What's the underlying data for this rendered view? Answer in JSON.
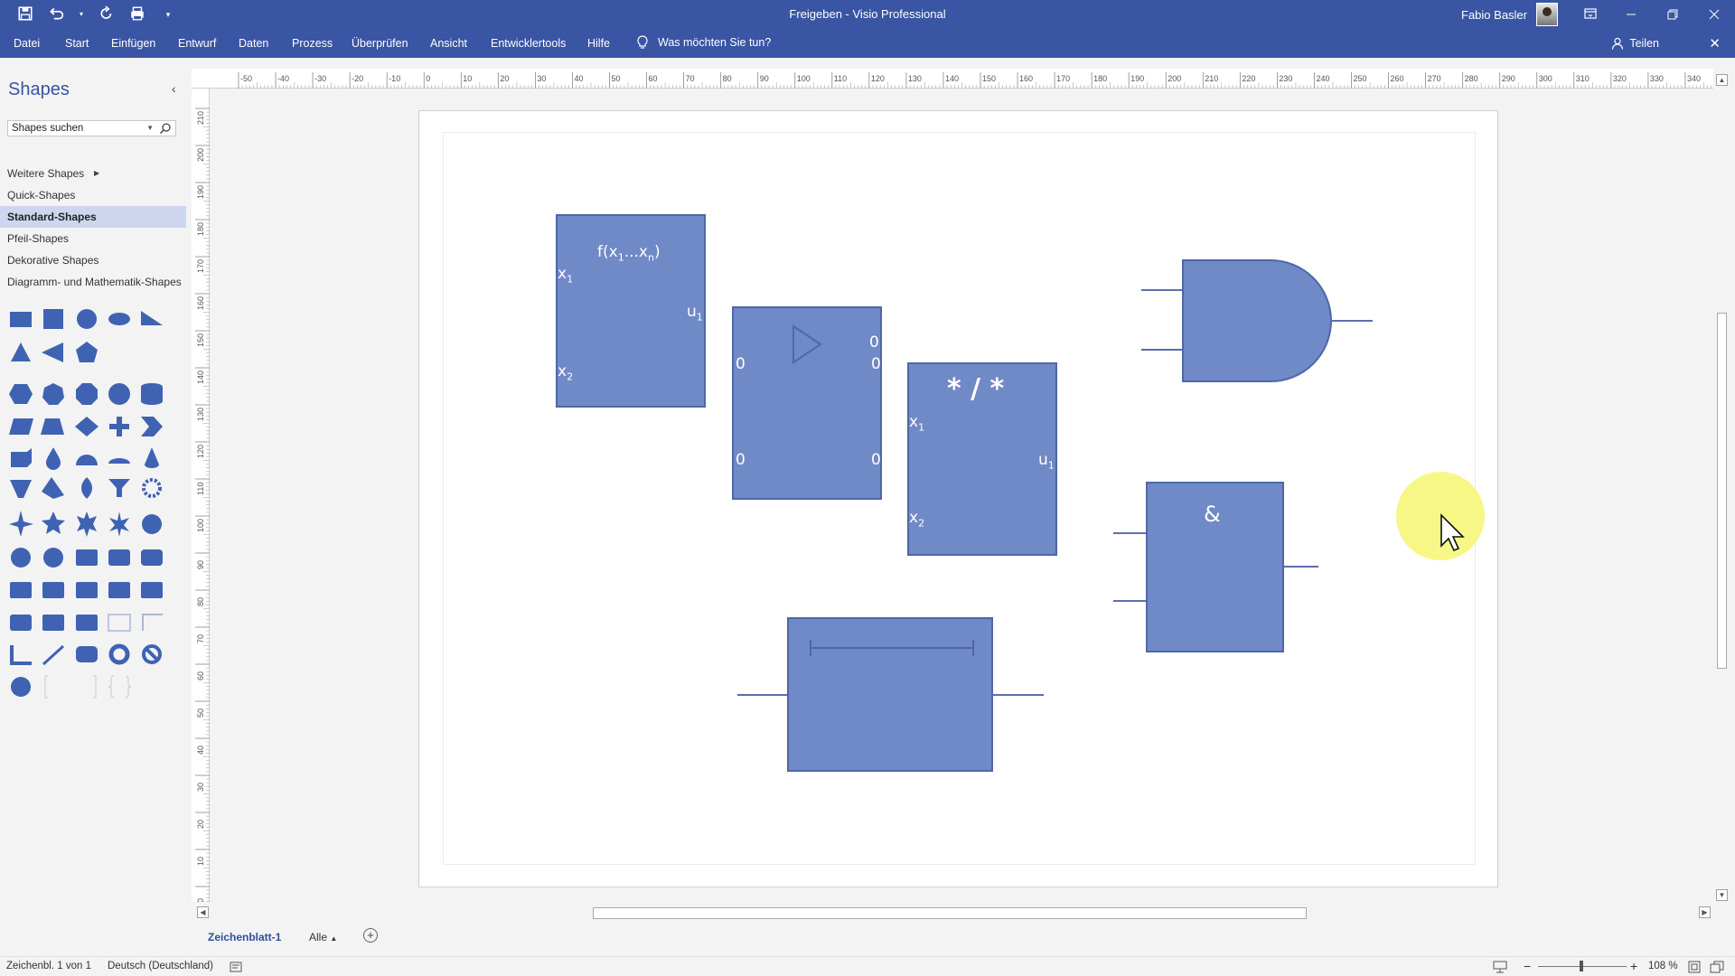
{
  "window": {
    "title": "Freigeben  -  Visio Professional",
    "user": "Fabio Basler"
  },
  "menu": {
    "items": [
      "Datei",
      "Start",
      "Einfügen",
      "Entwurf",
      "Daten",
      "Prozess",
      "Überprüfen",
      "Ansicht",
      "Entwicklertools",
      "Hilfe"
    ],
    "tellme": "Was möchten Sie tun?",
    "share": "Teilen"
  },
  "shapes_panel": {
    "title": "Shapes",
    "search_value": "Shapes suchen",
    "stencils": [
      {
        "label": "Weitere Shapes",
        "has_arrow": true
      },
      {
        "label": "Quick-Shapes"
      },
      {
        "label": "Standard-Shapes",
        "active": true
      },
      {
        "label": "Pfeil-Shapes"
      },
      {
        "label": "Dekorative Shapes"
      },
      {
        "label": "Diagramm- und Mathematik-Shapes"
      }
    ]
  },
  "ruler": {
    "h_labels": [
      "-50",
      "-40",
      "-30",
      "-20",
      "-10",
      "0",
      "10",
      "20",
      "30",
      "40",
      "50",
      "60",
      "70",
      "80",
      "90",
      "100",
      "110",
      "120",
      "130",
      "140",
      "150",
      "160",
      "170",
      "180",
      "190",
      "200",
      "210",
      "220",
      "230",
      "240",
      "250",
      "260",
      "270",
      "280",
      "290",
      "300",
      "310",
      "320",
      "330",
      "340"
    ],
    "v_labels": [
      "210",
      "200",
      "190",
      "180",
      "170",
      "160",
      "150",
      "140",
      "130",
      "120",
      "110",
      "100",
      "90",
      "80",
      "70",
      "60",
      "50",
      "40",
      "30",
      "20",
      "10",
      "0"
    ]
  },
  "diagram": {
    "func_block": {
      "title": "f(x",
      "sub1": "1",
      "dots": "...x",
      "subn": "n",
      "close": ")",
      "in1": "x",
      "in1_sub": "1",
      "in2": "x",
      "in2_sub": "2",
      "out": "u",
      "out_sub": "1"
    },
    "amp_block": {
      "out_top": "0",
      "in_left": "0",
      "out_mid": "0",
      "in_bot": "0",
      "out_bot": "0"
    },
    "muldiv_block": {
      "title": "* / *",
      "in1": "x",
      "in1_sub": "1",
      "in2": "x",
      "in2_sub": "2",
      "out": "u",
      "out_sub": "1"
    },
    "and_block": {
      "label": "&"
    }
  },
  "sheets": {
    "active": "Zeichenblatt-1",
    "all": "Alle"
  },
  "status": {
    "page": "Zeichenbl. 1 von 1",
    "language": "Deutsch (Deutschland)",
    "zoom": "108 %"
  },
  "colors": {
    "ribbon": "#3955a3",
    "shape_fill": "#7089c7",
    "shape_stroke": "#4f67a8",
    "active_stencil": "#cdd6ee",
    "cursor_halo": "#f6f678"
  }
}
